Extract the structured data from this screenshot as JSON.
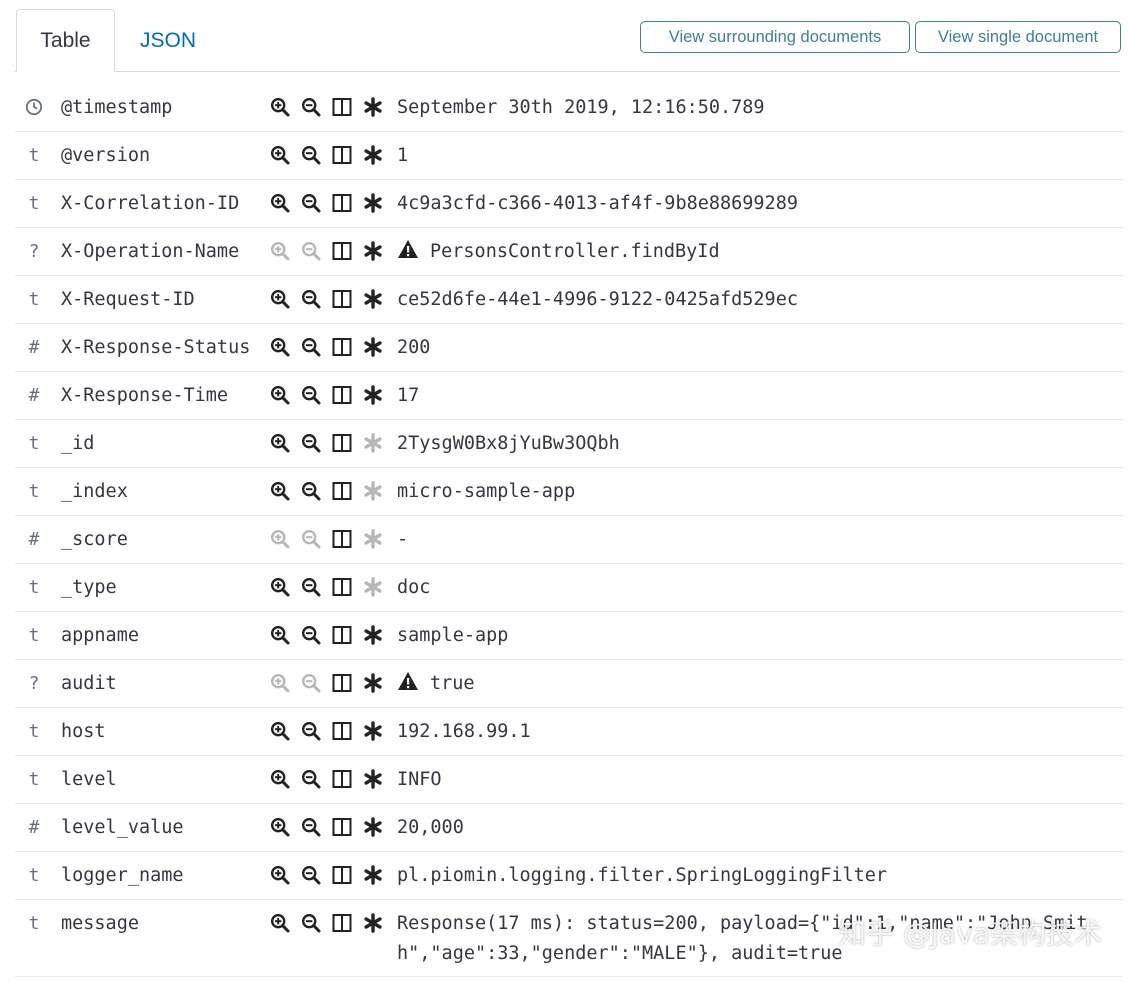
{
  "tabs": [
    {
      "label": "Table",
      "active": true
    },
    {
      "label": "JSON",
      "active": false
    }
  ],
  "header_buttons": {
    "surrounding": "View surrounding documents",
    "single": "View single document"
  },
  "colors": {
    "link_blue": "#006bb4",
    "button_border": "#3f7f97",
    "text": "#343741",
    "row_border": "#e6e9ee"
  },
  "icons": {
    "filter_for": "magnify-plus-icon",
    "filter_out": "magnify-minus-icon",
    "toggle_column": "table-column-icon",
    "filter_exists": "asterisk-icon",
    "warning": "warning-triangle-icon",
    "date_type": "clock-icon"
  },
  "fields": [
    {
      "type": "clock",
      "type_label": "",
      "name": "@timestamp",
      "value": "September 30th 2019, 12:16:50.789",
      "filters_enabled": true,
      "exists_enabled": true,
      "warning": false
    },
    {
      "type": "string",
      "type_label": "t",
      "name": "@version",
      "value": "1",
      "filters_enabled": true,
      "exists_enabled": true,
      "warning": false
    },
    {
      "type": "string",
      "type_label": "t",
      "name": "X-Correlation-ID",
      "value": "4c9a3cfd-c366-4013-af4f-9b8e88699289",
      "filters_enabled": true,
      "exists_enabled": true,
      "warning": false
    },
    {
      "type": "unknown",
      "type_label": "?",
      "name": "X-Operation-Name",
      "value": "PersonsController.findById",
      "filters_enabled": false,
      "exists_enabled": true,
      "warning": true
    },
    {
      "type": "string",
      "type_label": "t",
      "name": "X-Request-ID",
      "value": "ce52d6fe-44e1-4996-9122-0425afd529ec",
      "filters_enabled": true,
      "exists_enabled": true,
      "warning": false
    },
    {
      "type": "number",
      "type_label": "#",
      "name": "X-Response-Status",
      "value": "200",
      "filters_enabled": true,
      "exists_enabled": true,
      "warning": false
    },
    {
      "type": "number",
      "type_label": "#",
      "name": "X-Response-Time",
      "value": "17",
      "filters_enabled": true,
      "exists_enabled": true,
      "warning": false
    },
    {
      "type": "string",
      "type_label": "t",
      "name": "_id",
      "value": "2TysgW0Bx8jYuBw3OQbh",
      "filters_enabled": true,
      "exists_enabled": false,
      "warning": false
    },
    {
      "type": "string",
      "type_label": "t",
      "name": "_index",
      "value": "micro-sample-app",
      "filters_enabled": true,
      "exists_enabled": false,
      "warning": false
    },
    {
      "type": "number",
      "type_label": "#",
      "name": "_score",
      "value": " -",
      "filters_enabled": false,
      "exists_enabled": false,
      "warning": false
    },
    {
      "type": "string",
      "type_label": "t",
      "name": "_type",
      "value": "doc",
      "filters_enabled": true,
      "exists_enabled": false,
      "warning": false
    },
    {
      "type": "string",
      "type_label": "t",
      "name": "appname",
      "value": "sample-app",
      "filters_enabled": true,
      "exists_enabled": true,
      "warning": false
    },
    {
      "type": "unknown",
      "type_label": "?",
      "name": "audit",
      "value": "true",
      "filters_enabled": false,
      "exists_enabled": true,
      "warning": true
    },
    {
      "type": "string",
      "type_label": "t",
      "name": "host",
      "value": "192.168.99.1",
      "filters_enabled": true,
      "exists_enabled": true,
      "warning": false
    },
    {
      "type": "string",
      "type_label": "t",
      "name": "level",
      "value": "INFO",
      "filters_enabled": true,
      "exists_enabled": true,
      "warning": false
    },
    {
      "type": "number",
      "type_label": "#",
      "name": "level_value",
      "value": "20,000",
      "filters_enabled": true,
      "exists_enabled": true,
      "warning": false
    },
    {
      "type": "string",
      "type_label": "t",
      "name": "logger_name",
      "value": "pl.piomin.logging.filter.SpringLoggingFilter",
      "filters_enabled": true,
      "exists_enabled": true,
      "warning": false
    },
    {
      "type": "string",
      "type_label": "t",
      "name": "message",
      "value": "Response(17 ms): status=200, payload={\"id\":1,\"name\":\"John Smith\",\"age\":33,\"gender\":\"MALE\"}, audit=true",
      "filters_enabled": true,
      "exists_enabled": true,
      "warning": false,
      "multiline": true
    }
  ],
  "watermark": "知乎 @Java架构技术"
}
